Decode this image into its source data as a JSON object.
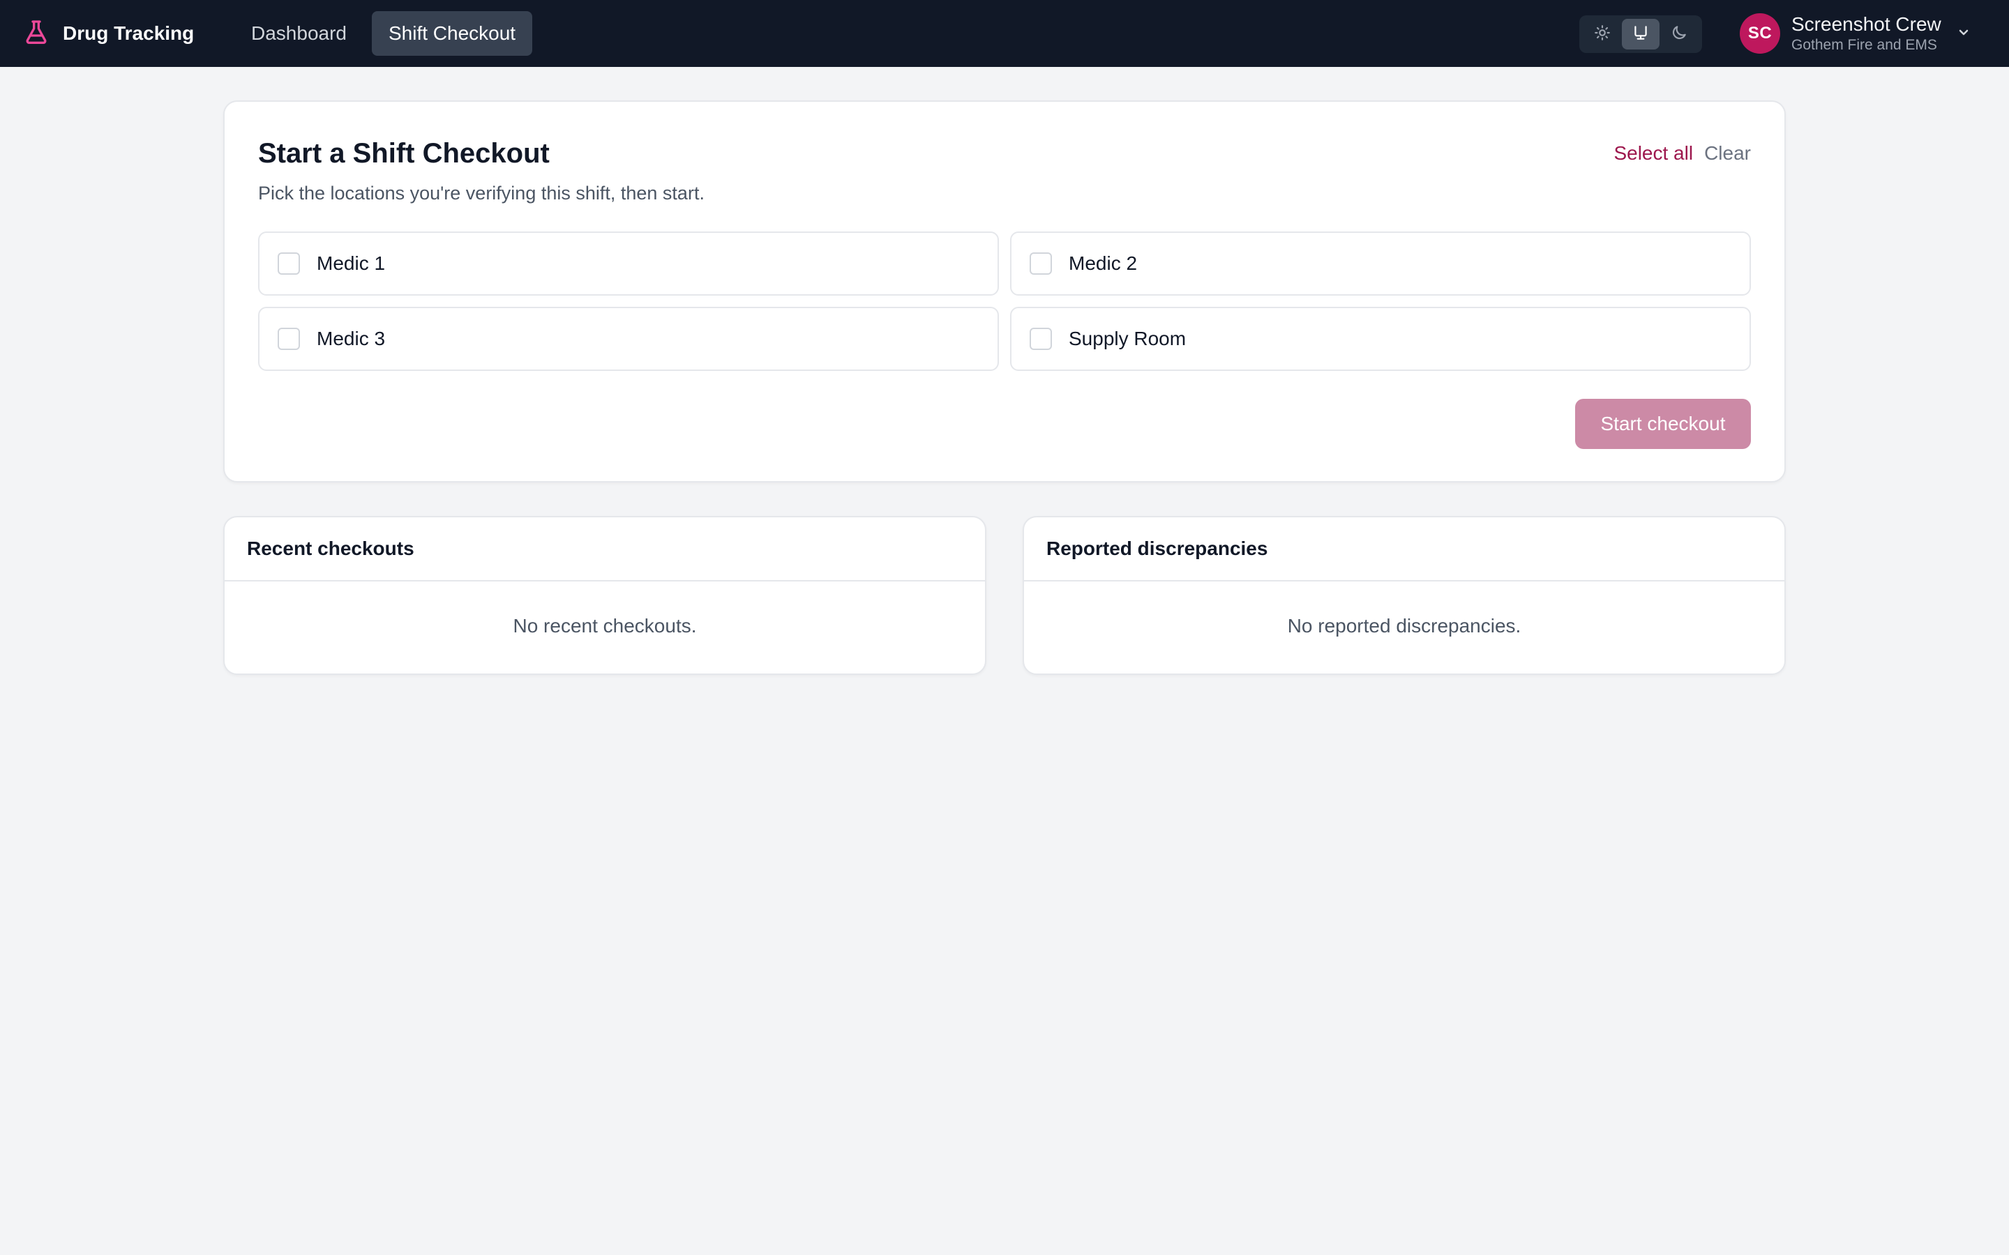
{
  "app": {
    "name": "Drug Tracking",
    "brand_color": "#ec4899"
  },
  "nav": {
    "items": [
      {
        "label": "Dashboard",
        "active": false
      },
      {
        "label": "Shift Checkout",
        "active": true
      }
    ]
  },
  "theme": {
    "options": [
      "sun-icon",
      "monitor-icon",
      "moon-icon"
    ],
    "selected": "monitor-icon"
  },
  "user": {
    "initials": "SC",
    "name": "Screenshot Crew",
    "org": "Gothem Fire and EMS",
    "avatar_color": "#be185d"
  },
  "checkout": {
    "title": "Start a Shift Checkout",
    "subtitle": "Pick the locations you're verifying this shift, then start.",
    "select_all": "Select all",
    "clear": "Clear",
    "locations": [
      {
        "label": "Medic 1",
        "checked": false
      },
      {
        "label": "Medic 2",
        "checked": false
      },
      {
        "label": "Medic 3",
        "checked": false
      },
      {
        "label": "Supply Room",
        "checked": false
      }
    ],
    "start_button": "Start checkout",
    "start_enabled": false,
    "accent_color": "#9d174d"
  },
  "recent": {
    "title": "Recent checkouts",
    "empty": "No recent checkouts."
  },
  "discrepancies": {
    "title": "Reported discrepancies",
    "empty": "No reported discrepancies."
  }
}
